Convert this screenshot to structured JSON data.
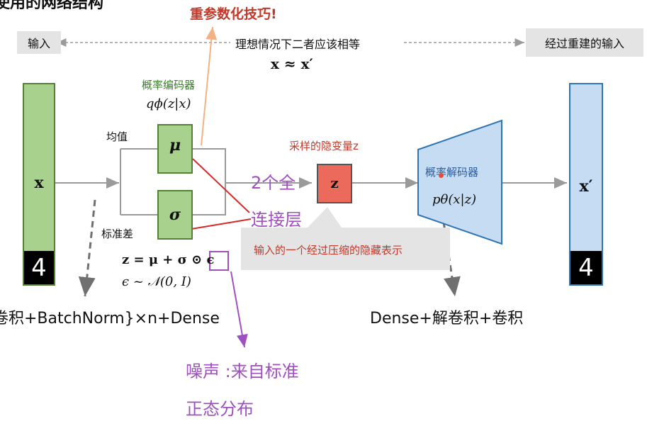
{
  "header": {
    "partial_title": "变使用的网络结构",
    "reparam_trick": "重参数化技巧!"
  },
  "io": {
    "input_label": "输入",
    "output_label": "经过重建的输入",
    "ideal_text": "理想情况下二者应该相等",
    "approx_eq": "x ≈ x′"
  },
  "encoder": {
    "title": "概率编码器",
    "formula": "qϕ(z|x)",
    "mean_label": "均值",
    "std_label": "标准差",
    "mu_symbol": "μ",
    "sigma_symbol": "σ",
    "input_symbol": "x",
    "digit": "4",
    "reparam_eq": "z = μ + σ ⊙ ϵ",
    "noise_dist": "ϵ ~ 𝒩(0, I)",
    "structure": "卷积+BatchNorm}×n+Dense"
  },
  "latent": {
    "label": "采样的隐变量z",
    "symbol": "z",
    "fc_note_line1": "2个全",
    "fc_note_line2": "连接层",
    "compressed_note": "输入的一个经过压缩的隐藏表示"
  },
  "decoder": {
    "title": "概率解码器",
    "formula": "pθ(x|z)",
    "output_symbol": "x′",
    "digit": "4",
    "structure": "Dense+解卷积+卷积"
  },
  "noise_note": {
    "line1": "噪声 :来自标准",
    "line2": "正态分布"
  },
  "colors": {
    "encoder_green": "#a9d18e",
    "decoder_blue": "#c5dcf2",
    "latent_red": "#ec6a5c",
    "annotation_purple": "#a04fc0",
    "reparam_red": "#c0392b",
    "arrow_orange": "#f4b183"
  }
}
